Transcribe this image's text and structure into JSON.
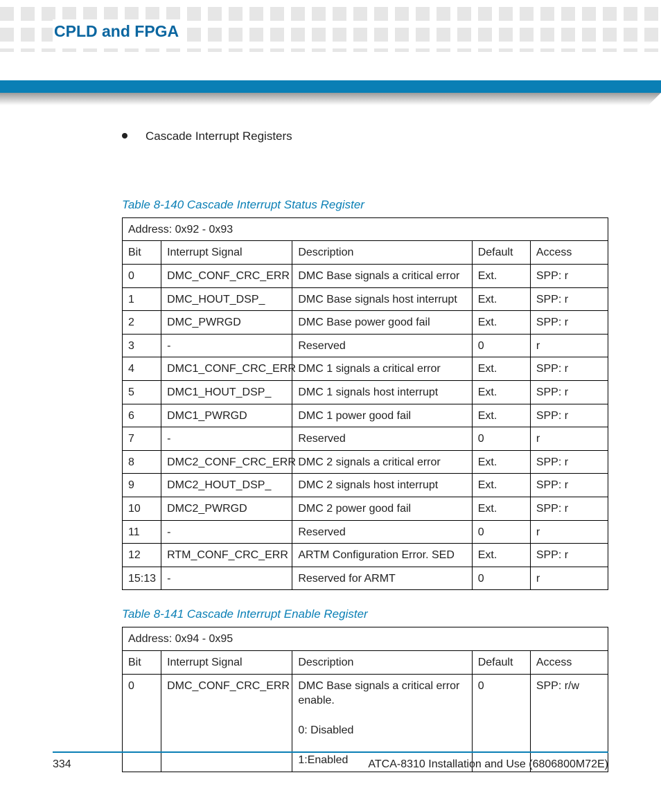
{
  "header": {
    "section_title": "CPLD and FPGA"
  },
  "bullet": {
    "text": "Cascade Interrupt Registers"
  },
  "table140": {
    "caption": "Table 8-140 Cascade Interrupt Status Register",
    "address": "Address: 0x92 - 0x93",
    "head": {
      "bit": "Bit",
      "signal": "Interrupt Signal",
      "desc": "Description",
      "def": "Default",
      "acc": "Access"
    },
    "rows": [
      {
        "bit": "0",
        "signal": "DMC_CONF_CRC_ERR",
        "desc": "DMC Base signals a critical error",
        "def": "Ext.",
        "acc": "SPP: r"
      },
      {
        "bit": "1",
        "signal": "DMC_HOUT_DSP_",
        "desc": "DMC Base signals host interrupt",
        "def": "Ext.",
        "acc": "SPP: r"
      },
      {
        "bit": "2",
        "signal": "DMC_PWRGD",
        "desc": "DMC Base power good fail",
        "def": "Ext.",
        "acc": "SPP: r"
      },
      {
        "bit": "3",
        "signal": "-",
        "desc": "Reserved",
        "def": "0",
        "acc": "r"
      },
      {
        "bit": "4",
        "signal": "DMC1_CONF_CRC_ERR",
        "desc": "DMC 1 signals a critical error",
        "def": "Ext.",
        "acc": "SPP: r"
      },
      {
        "bit": "5",
        "signal": "DMC1_HOUT_DSP_",
        "desc": "DMC 1 signals host interrupt",
        "def": "Ext.",
        "acc": "SPP: r"
      },
      {
        "bit": "6",
        "signal": "DMC1_PWRGD",
        "desc": "DMC 1 power good fail",
        "def": "Ext.",
        "acc": "SPP: r"
      },
      {
        "bit": "7",
        "signal": "-",
        "desc": "Reserved",
        "def": "0",
        "acc": "r"
      },
      {
        "bit": "8",
        "signal": "DMC2_CONF_CRC_ERR",
        "desc": "DMC 2 signals a critical error",
        "def": "Ext.",
        "acc": "SPP: r"
      },
      {
        "bit": "9",
        "signal": "DMC2_HOUT_DSP_",
        "desc": "DMC 2 signals host interrupt",
        "def": "Ext.",
        "acc": "SPP: r"
      },
      {
        "bit": "10",
        "signal": "DMC2_PWRGD",
        "desc": "DMC 2 power good fail",
        "def": "Ext.",
        "acc": "SPP: r"
      },
      {
        "bit": "11",
        "signal": "-",
        "desc": "Reserved",
        "def": "0",
        "acc": "r"
      },
      {
        "bit": "12",
        "signal": "RTM_CONF_CRC_ERR",
        "desc": "ARTM Configuration Error. SED",
        "def": "Ext.",
        "acc": "SPP: r"
      },
      {
        "bit": "15:13",
        "signal": "-",
        "desc": "Reserved for ARMT",
        "def": "0",
        "acc": "r"
      }
    ]
  },
  "table141": {
    "caption": "Table 8-141 Cascade Interrupt Enable Register",
    "address": "Address: 0x94 - 0x95",
    "head": {
      "bit": "Bit",
      "signal": "Interrupt Signal",
      "desc": "Description",
      "def": "Default",
      "acc": "Access"
    },
    "rows": [
      {
        "bit": "0",
        "signal": "DMC_CONF_CRC_ERR",
        "desc": "DMC Base signals a critical error enable.\n0: Disabled\n1:Enabled",
        "def": "0",
        "acc": "SPP: r/w"
      }
    ]
  },
  "footer": {
    "page": "334",
    "doc": "ATCA-8310 Installation and Use (6806800M72E)"
  }
}
